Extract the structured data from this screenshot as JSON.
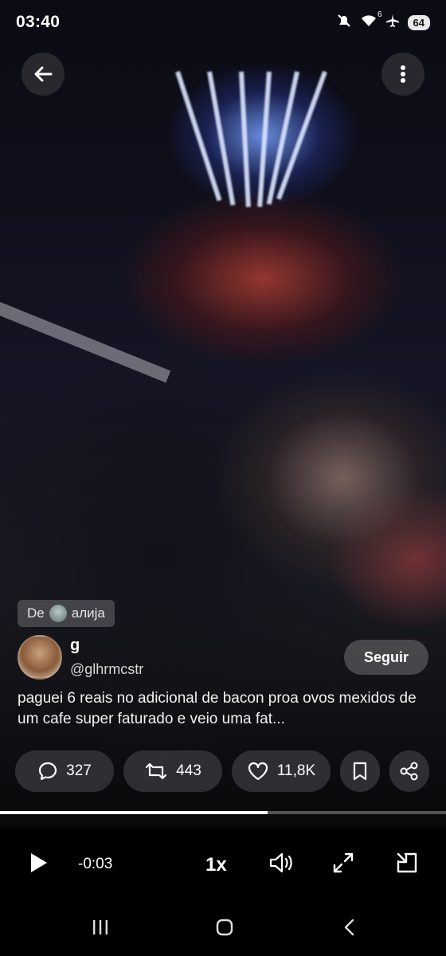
{
  "status_bar": {
    "time": "03:40",
    "icons": [
      "mute-icon",
      "wifi-icon",
      "airplane-icon"
    ],
    "wifi_badge": "6",
    "battery": "64"
  },
  "top_bar": {
    "back_icon": "arrow-left-icon",
    "more_icon": "more-vertical-icon"
  },
  "source": {
    "prefix": "De",
    "name": "алија"
  },
  "author": {
    "name": "g",
    "handle": "@glhrmcstr",
    "follow_label": "Seguir"
  },
  "tweet": {
    "text": "paguei 6 reais no adicional de bacon proa ovos mexidos de um cafe super faturado e veio uma fat..."
  },
  "actions": {
    "replies": "327",
    "retweets": "443",
    "likes": "11,8K"
  },
  "video": {
    "progress": 0.6,
    "remaining": "-0:03",
    "speed": "1x"
  },
  "colors": {
    "background": "#000000",
    "pill": "#46464b",
    "text": "#ffffff"
  }
}
